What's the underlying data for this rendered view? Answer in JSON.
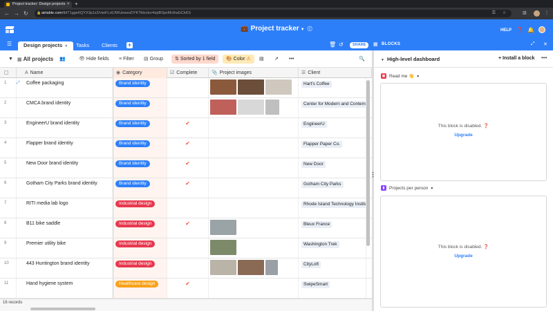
{
  "browser": {
    "tab_title": "Project tracker: Design projects",
    "url_host": "airtable.com",
    "url_path": "/tblT1gge6QYX3p1z2/viwFLv0JWUewesDYK?blocks=bipBSpvMcthaGCkKS",
    "nav_back": "←",
    "nav_forward": "→",
    "nav_reload": "↻"
  },
  "app": {
    "base_name": "Project tracker",
    "help_label": "HELP",
    "brand_color": "#2d7ff9"
  },
  "tables": {
    "items": [
      {
        "label": "Design projects"
      },
      {
        "label": "Tasks"
      },
      {
        "label": "Clients"
      }
    ],
    "share_label": "SHARE"
  },
  "blocks_bar": {
    "label": "BLOCKS"
  },
  "view": {
    "name": "All projects",
    "hide_fields": "Hide fields",
    "filter": "Filter",
    "group": "Group",
    "sorted": "Sorted by 1 field",
    "color": "Color"
  },
  "columns": {
    "name": "Name",
    "category": "Category",
    "complete": "Complete",
    "images": "Project images",
    "client": "Client"
  },
  "rows": [
    {
      "num": "1",
      "name": "Coffee packaging",
      "category": "Brand identity",
      "cat_color": "#2d7ff9",
      "complete": "",
      "images": [
        [
          "#8b5a3c",
          38
        ],
        [
          "#6b4f3a",
          38
        ],
        [
          "#cfc8bf",
          38
        ]
      ],
      "client": "Hart's Coffee"
    },
    {
      "num": "2",
      "name": "CMCA brand identity",
      "category": "Brand identity",
      "cat_color": "#2d7ff9",
      "complete": "",
      "images": [
        [
          "#c0605a",
          38
        ],
        [
          "#d8d8d8",
          38
        ],
        [
          "#bfbfbf",
          20
        ]
      ],
      "client": "Center for Modern and Contemporary Art"
    },
    {
      "num": "3",
      "name": "EngineerU brand identity",
      "category": "Brand identity",
      "cat_color": "#2d7ff9",
      "complete": "✔",
      "images": [],
      "client": "EngineerU"
    },
    {
      "num": "4",
      "name": "Flapper brand identity",
      "category": "Brand identity",
      "cat_color": "#2d7ff9",
      "complete": "✔",
      "images": [],
      "client": "Flapper Paper Co."
    },
    {
      "num": "5",
      "name": "New Door brand identity",
      "category": "Brand identity",
      "cat_color": "#2d7ff9",
      "complete": "✔",
      "images": [],
      "client": "New Door"
    },
    {
      "num": "6",
      "name": "Gotham City Parks brand identity",
      "category": "Brand identity",
      "cat_color": "#2d7ff9",
      "complete": "✔",
      "images": [],
      "client": "Gotham City Parks"
    },
    {
      "num": "7",
      "name": "RITI media lab logo",
      "category": "Industrial design",
      "cat_color": "#e8384f",
      "complete": "",
      "images": [],
      "client": "Rhode Island Technology Institute"
    },
    {
      "num": "8",
      "name": "B11 bike saddle",
      "category": "Industrial design",
      "cat_color": "#e8384f",
      "complete": "✔",
      "images": [
        [
          "#9aa3a6",
          38
        ]
      ],
      "client": "Bleux France"
    },
    {
      "num": "9",
      "name": "Premier utility bike",
      "category": "Industrial design",
      "cat_color": "#e8384f",
      "complete": "",
      "images": [
        [
          "#7d8a6a",
          38
        ]
      ],
      "client": "Washington Trek"
    },
    {
      "num": "10",
      "name": "443 Huntington brand identity",
      "category": "Industrial design",
      "cat_color": "#e8384f",
      "complete": "",
      "images": [
        [
          "#b9b3a8",
          38
        ],
        [
          "#8a6a55",
          38
        ],
        [
          "#9b9fa6",
          18
        ]
      ],
      "client": "CityLoft"
    },
    {
      "num": "11",
      "name": "Hand hygiene system",
      "category": "Healthcare design",
      "cat_color": "#f7a21b",
      "complete": "✔",
      "images": [],
      "client": "SwipeSmart"
    }
  ],
  "footer": {
    "count": "16 records"
  },
  "dashboard": {
    "title": "High-level dashboard",
    "install": "Install a block",
    "blocks": [
      {
        "title": "Read me 👋",
        "icon_color": "#e8384f",
        "disabled": "This block is disabled.",
        "upgrade": "Upgrade"
      },
      {
        "title": "Projects per person",
        "icon_color": "#8b46ff",
        "disabled": "This block is disabled.",
        "upgrade": "Upgrade"
      }
    ]
  }
}
